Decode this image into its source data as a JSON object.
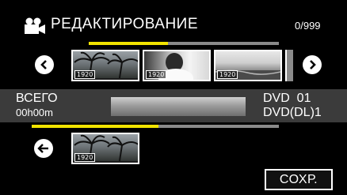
{
  "header": {
    "title": "РЕДАКТИРОВАНИЕ",
    "counter": "0/999"
  },
  "strip": {
    "thumbnails": [
      {
        "tag": "1920"
      },
      {
        "tag": "1920"
      },
      {
        "tag": "1920"
      }
    ]
  },
  "info": {
    "total_label": "ВСЕГО",
    "total_time": "00h00m",
    "disc_label": "DVD  01",
    "disc_type": "DVD(DL)1"
  },
  "selected": {
    "thumbnails": [
      {
        "tag": "1920"
      }
    ]
  },
  "footer": {
    "save_label": "СОХР."
  },
  "colors": {
    "background": "#000000",
    "accent": "#f2e400",
    "panel": "#3b3b3b"
  },
  "icons": {
    "camera": "movie-camera-icon",
    "prev": "chevron-left-circle-icon",
    "next": "chevron-right-circle-icon",
    "back": "arrow-left-circle-icon"
  }
}
